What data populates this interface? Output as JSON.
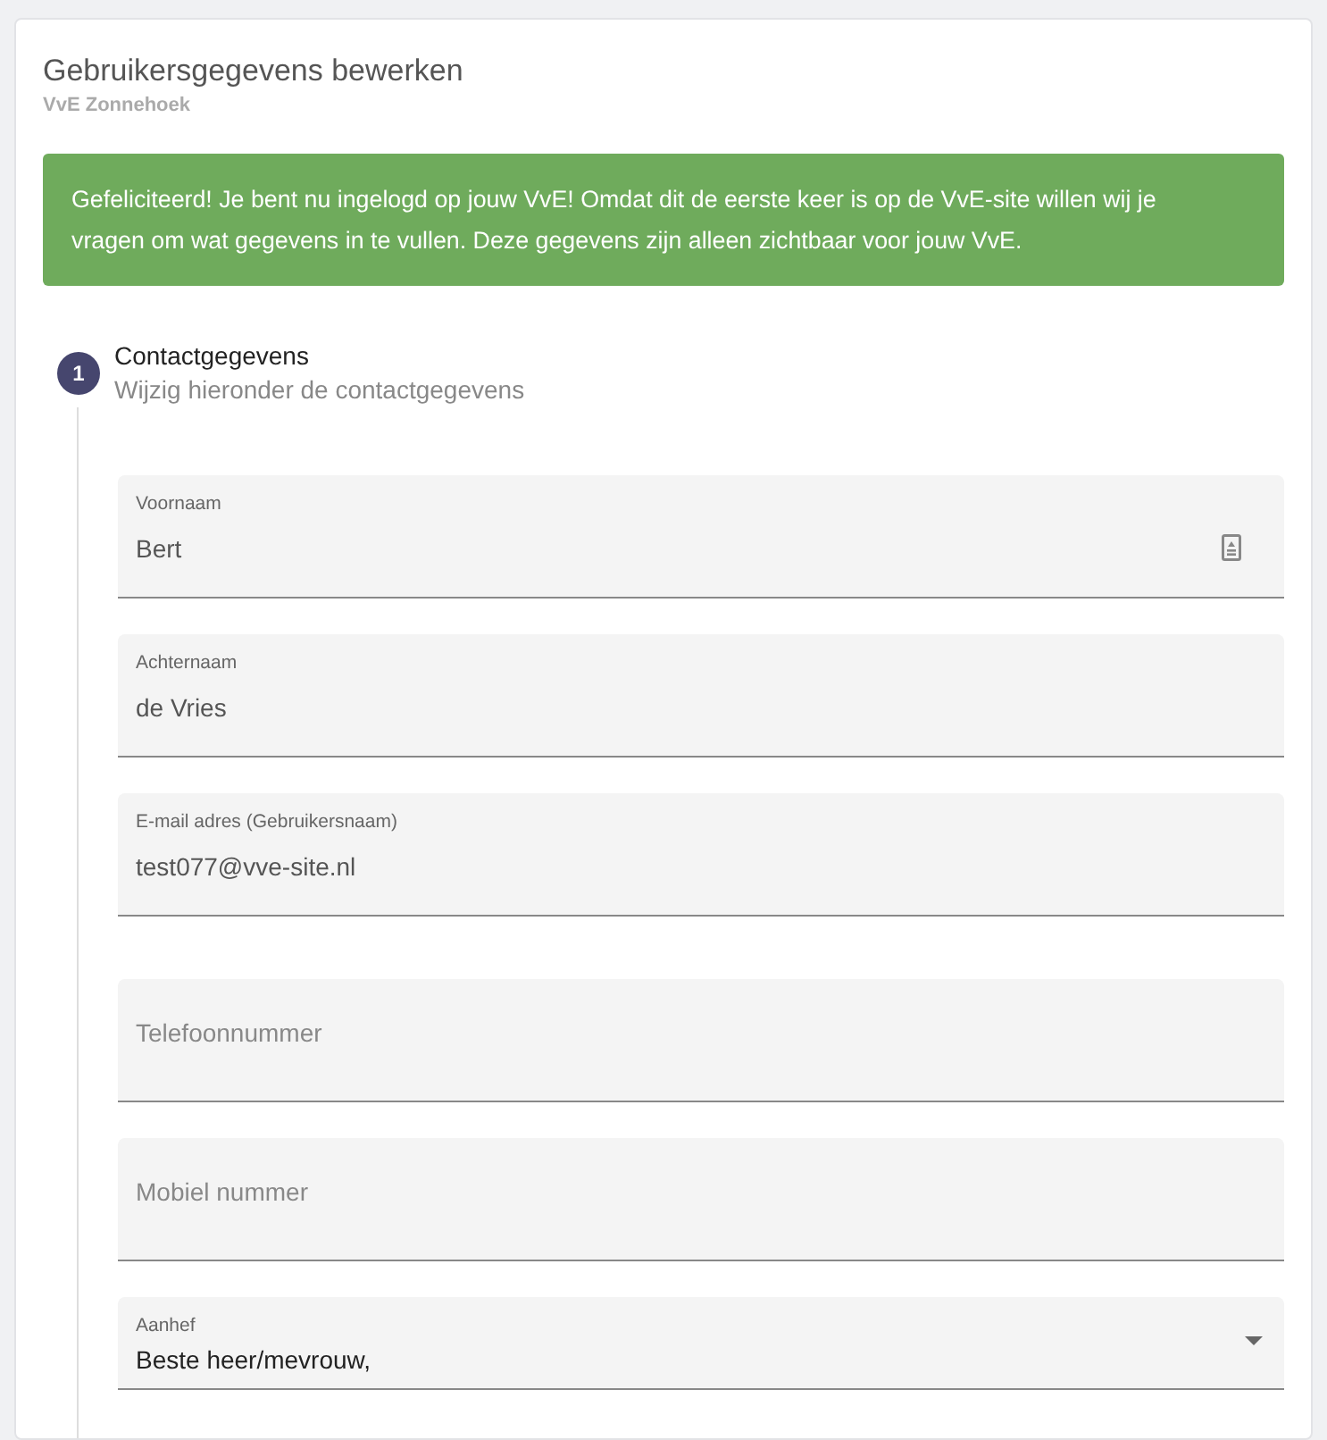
{
  "header": {
    "title": "Gebruikersgegevens bewerken",
    "subtitle": "VvE Zonnehoek"
  },
  "alert": "Gefeliciteerd! Je bent nu ingelogd op jouw VvE! Omdat dit de eerste keer is op de VvE-site willen wij je vragen om wat gegevens in te vullen. Deze gegevens zijn alleen zichtbaar voor jouw VvE.",
  "step": {
    "number": "1",
    "title": "Contactgegevens",
    "subtitle": "Wijzig hieronder de contactgegevens"
  },
  "fields": [
    {
      "kind": "text",
      "label": "Voornaam",
      "value": "Bert",
      "autofill": true
    },
    {
      "kind": "text",
      "label": "Achternaam",
      "value": "de Vries",
      "autofill": false
    },
    {
      "kind": "text",
      "label": "E-mail adres (Gebruikersnaam)",
      "value": "test077@vve-site.nl",
      "autofill": false
    },
    {
      "kind": "text",
      "placeholder": "Telefoonnummer",
      "autofill": false
    },
    {
      "kind": "text",
      "placeholder": "Mobiel nummer",
      "autofill": false
    },
    {
      "kind": "select",
      "label": "Aanhef",
      "value": "Beste heer/mevrouw,",
      "autofill": false
    }
  ]
}
